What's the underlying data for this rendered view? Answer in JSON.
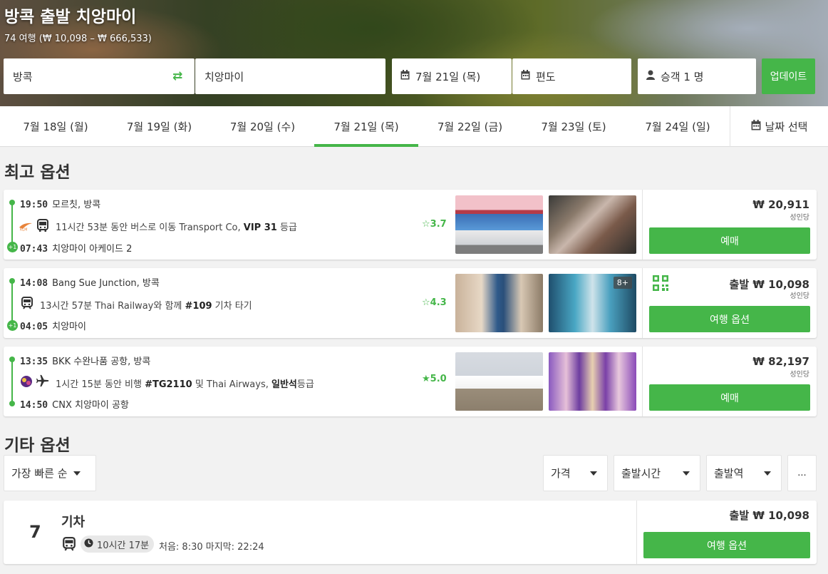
{
  "hero": {
    "title": "방콕 출발 치앙마이",
    "subtitle": "74 여행 (₩ 10,098 – ₩ 666,533)"
  },
  "search": {
    "from": "방콕",
    "to": "치앙마이",
    "depart_date": "7월 21일 (목)",
    "return": "편도",
    "passengers": "승객 1 명",
    "update_label": "업데이트"
  },
  "date_tabs": [
    "7월 18일 (월)",
    "7월 19일 (화)",
    "7월 20일 (수)",
    "7월 21일 (목)",
    "7월 22일 (금)",
    "7월 23일 (토)",
    "7월 24일 (일)"
  ],
  "date_select_label": "날짜 선택",
  "best_title": "최고 옵션",
  "best": [
    {
      "dep_time": "19:50",
      "dep_place": "모르칫, 방콕",
      "desc_pre": "11시간 53분 동안 버스로 이동 Transport Co, ",
      "desc_bold": "VIP 31",
      "desc_post": " 등급",
      "arr_time": "07:43",
      "arr_place": "치앙마이 아케이드 2",
      "rating": "3.7",
      "price": "₩ 20,911",
      "per": "성인당",
      "button": "예매"
    },
    {
      "dep_time": "14:08",
      "dep_place": "Bang Sue Junction, 방콕",
      "desc_pre": "13시간 57분 Thai Railway와 함께 ",
      "desc_bold": "#109",
      "desc_post": " 기차 타기",
      "arr_time": "04:05",
      "arr_place": "치앙마이",
      "rating": "4.3",
      "price": "출발 ₩ 10,098",
      "per": "성인당",
      "button": "여행 옵션",
      "more_photos": "8+"
    },
    {
      "dep_time": "13:35",
      "dep_place": "BKK 수완나품 공항, 방콕",
      "desc_pre": "1시간 15분 동안 비행 ",
      "desc_bold": "#TG2110",
      "desc_mid": " 및 Thai Airways, ",
      "desc_bold2": "일반석",
      "desc_post": "등급",
      "arr_time": "14:50",
      "arr_place": "CNX 치앙마이 공항",
      "rating": "5.0",
      "price": "₩ 82,197",
      "per": "성인당",
      "button": "예매"
    }
  ],
  "plus_one": "+1",
  "other_title": "기타 옵션",
  "filters": {
    "sort": "가장 빠른 순",
    "price": "가격",
    "departure_time": "출발시간",
    "departure_station": "출발역",
    "more": "..."
  },
  "other": {
    "count": "7",
    "mode": "기차",
    "duration": "10시간 17분",
    "schedule": "처음: 8:30 마지막: 22:24",
    "price": "출발 ₩ 10,098",
    "button": "여행 옵션"
  },
  "colors": {
    "accent": "#45b649"
  }
}
